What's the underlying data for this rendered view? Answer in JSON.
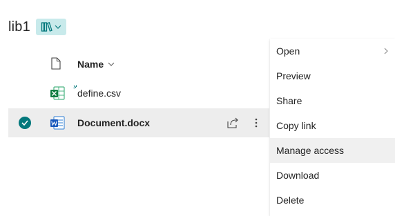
{
  "header": {
    "library_name": "lib1"
  },
  "columns": {
    "name_label": "Name"
  },
  "files": [
    {
      "name": "define.csv",
      "type": "excel-file-icon",
      "selected": false
    },
    {
      "name": "Document.docx",
      "type": "word-file-icon",
      "selected": true
    }
  ],
  "context_menu": {
    "items": [
      {
        "label": "Open",
        "has_submenu": true
      },
      {
        "label": "Preview"
      },
      {
        "label": "Share"
      },
      {
        "label": "Copy link"
      },
      {
        "label": "Manage access",
        "highlighted": true
      },
      {
        "label": "Download"
      },
      {
        "label": "Delete"
      }
    ]
  },
  "colors": {
    "accent": "#03787c",
    "view_button_bg": "#c8eaeb",
    "selected_row_bg": "#ededed",
    "excel_green": "#107c41",
    "word_blue": "#185abd"
  }
}
